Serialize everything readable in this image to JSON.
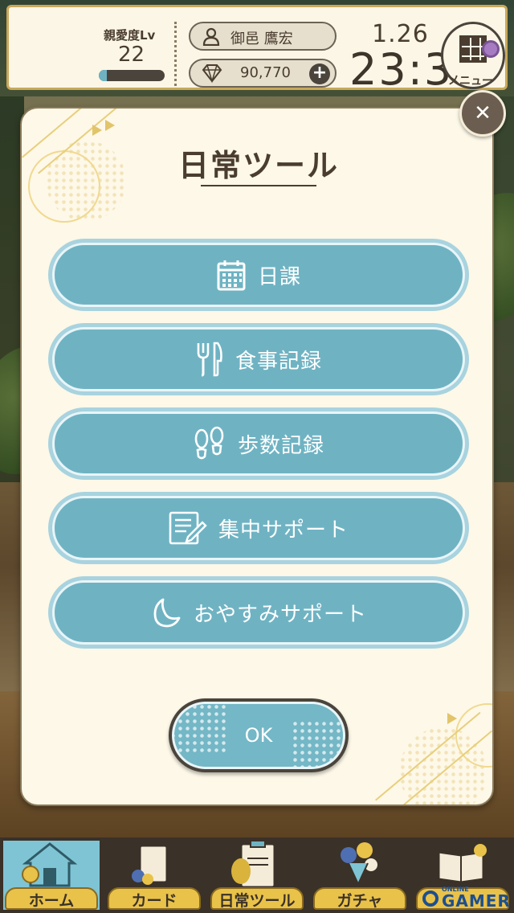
{
  "status_bar": {
    "affection_label": "親愛度Lv",
    "affection_level": "22",
    "affection_progress": 0.12,
    "user_name": "御邑 鷹宏",
    "gem_count": "90,770",
    "date": "1.26",
    "time": "23:3",
    "menu_label": "メニュー"
  },
  "dialog": {
    "title": "日常ツール",
    "buttons": [
      {
        "label": "日課",
        "icon": "calendar-icon"
      },
      {
        "label": "食事記録",
        "icon": "fork-knife-icon"
      },
      {
        "label": "歩数記録",
        "icon": "footprints-icon"
      },
      {
        "label": "集中サポート",
        "icon": "note-pencil-icon"
      },
      {
        "label": "おやすみサポート",
        "icon": "moon-icon"
      }
    ],
    "ok_label": "OK",
    "close_icon": "close-icon"
  },
  "bottom_nav": {
    "items": [
      {
        "label": "ホーム",
        "active": true
      },
      {
        "label": "カード",
        "active": false
      },
      {
        "label": "日常ツール",
        "active": false
      },
      {
        "label": "ガチャ",
        "active": false
      },
      {
        "label": "",
        "active": false
      }
    ]
  },
  "watermark": {
    "small": "ONLINE",
    "big": "GAMER"
  },
  "colors": {
    "button_fill": "#6fb3c3",
    "button_outer": "#a8d3df",
    "panel_bg": "#fdf8e8",
    "text_dark": "#4a3d2f",
    "nav_active": "#7ec4d4",
    "nav_tab": "#e9c24a"
  }
}
